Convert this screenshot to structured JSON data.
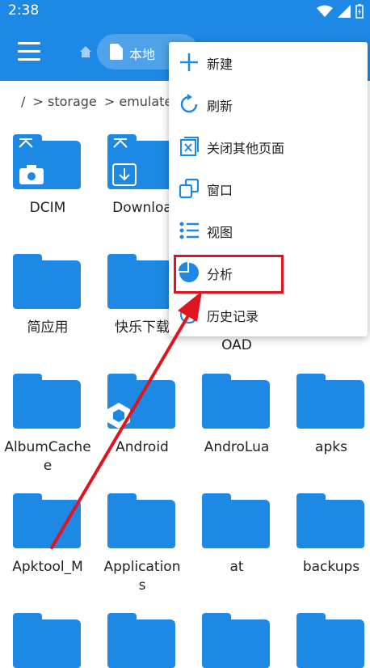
{
  "status": {
    "time": "2:38"
  },
  "appbar": {
    "tab_label": "本地"
  },
  "breadcrumb": {
    "root": "/",
    "parts": [
      "> storage",
      "> emulated",
      ">"
    ]
  },
  "files": [
    {
      "label": "DCIM"
    },
    {
      "label": "Downloa"
    },
    {
      "label": "简应用"
    },
    {
      "label": "快乐下载"
    },
    {
      "label": "OAD"
    },
    {
      "label": "AlbumCache\ne"
    },
    {
      "label": "Android"
    },
    {
      "label": "AndroLua"
    },
    {
      "label": "apks"
    },
    {
      "label": "Apktool_M"
    },
    {
      "label": "Application\ns"
    },
    {
      "label": "at"
    },
    {
      "label": "backups"
    }
  ],
  "menu": {
    "items": [
      {
        "label": "新建",
        "icon": "plus-icon"
      },
      {
        "label": "刷新",
        "icon": "refresh-icon"
      },
      {
        "label": "关闭其他页面",
        "icon": "close-tabs-icon"
      },
      {
        "label": "窗口",
        "icon": "window-icon"
      },
      {
        "label": "视图",
        "icon": "list-view-icon"
      },
      {
        "label": "分析",
        "icon": "pie-chart-icon"
      },
      {
        "label": "历史记录",
        "icon": "history-icon"
      }
    ]
  },
  "colors": {
    "accent": "#1e88e5",
    "highlight": "#e0141e"
  }
}
